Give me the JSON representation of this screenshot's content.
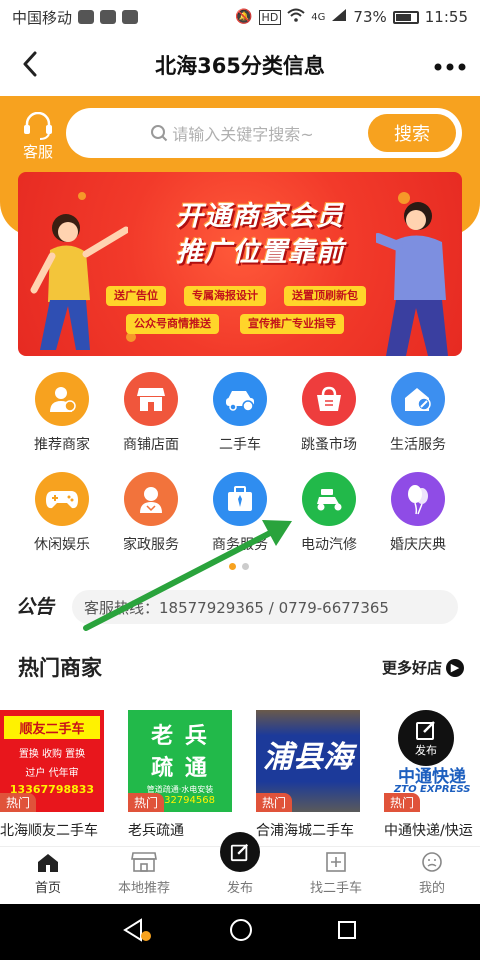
{
  "status_bar": {
    "carrier": "中国移动",
    "battery": "73%",
    "time": "11:55",
    "network": "4G"
  },
  "titlebar": {
    "title": "北海365分类信息"
  },
  "header": {
    "service_label": "客服",
    "search_placeholder": "请输入关键字搜索~",
    "search_button": "搜索"
  },
  "banner": {
    "line1": "开通商家会员",
    "line2": "推广位置靠前",
    "tags": [
      "送广告位",
      "专属海报设计",
      "送置顶刷新包",
      "公众号商情推送",
      "宣传推广专业指导"
    ]
  },
  "categories": [
    {
      "label": "推荐商家",
      "icon": "merchant-icon",
      "color": "#f7a21f"
    },
    {
      "label": "商铺店面",
      "icon": "storefront-icon",
      "color": "#f0563c"
    },
    {
      "label": "二手车",
      "icon": "car-icon",
      "color": "#2f8df0"
    },
    {
      "label": "跳蚤市场",
      "icon": "basket-icon",
      "color": "#ee3d3d"
    },
    {
      "label": "生活服务",
      "icon": "home-wrench-icon",
      "color": "#3c8ff0"
    },
    {
      "label": "休闲娱乐",
      "icon": "gamepad-icon",
      "color": "#f7a21f"
    },
    {
      "label": "家政服务",
      "icon": "housekeeper-icon",
      "color": "#f2733c"
    },
    {
      "label": "商务服务",
      "icon": "briefcase-icon",
      "color": "#2f8df0"
    },
    {
      "label": "电动汽修",
      "icon": "scooter-icon",
      "color": "#22b94a"
    },
    {
      "label": "婚庆庆典",
      "icon": "balloon-icon",
      "color": "#8f4ce6"
    }
  ],
  "notice": {
    "tag": "公告",
    "text": "客服热线：18577929365 / 0779-6677365"
  },
  "hot": {
    "title": "热门商家",
    "more": "更多好店"
  },
  "shops": [
    {
      "name": "北海顺友二手车",
      "badge": "热门",
      "img_line1": "顺友二手车",
      "img_line2": "置换 收购 置换",
      "img_line3": "过户 代年审",
      "img_line4": "13367798833"
    },
    {
      "name": "老兵疏通",
      "badge": "热门",
      "img_line1": "老 兵",
      "img_line2": "疏 通",
      "img_line3": "管道疏通·水电安装",
      "img_line4": "13132794568"
    },
    {
      "name": "合浦海城二手车",
      "badge": "热门",
      "img_line1": "浦县海"
    },
    {
      "name": "中通快递/快运",
      "badge": "热门",
      "img_line1": "中通快递",
      "img_line2": "ZTO EXPRESS"
    }
  ],
  "float_button": {
    "label": "发布"
  },
  "tabbar": {
    "items": [
      "首页",
      "本地推荐",
      "发布",
      "找二手车",
      "我的"
    ]
  }
}
